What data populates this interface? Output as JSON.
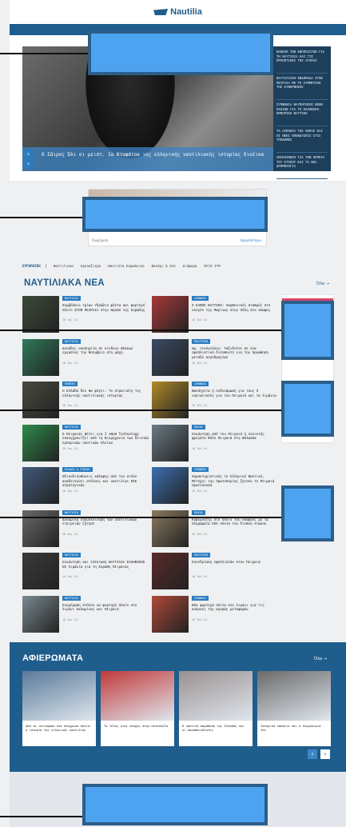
{
  "header": {
    "logo_text": "Nautilia"
  },
  "hero": {
    "caption": "Ο Σάιρος Ώλι οι μειστ. Ια Νταφάτοα ιης ελληνικής ναυτιλιακής ιστορίας διοέικα",
    "nav_prev": "‹",
    "nav_next": "›",
    "side_items": [
      "ΕΚΘΕΣΗ ΤΩΝ ΕΦΟΠΛΙΣΤΩΝ ΓΙΑ ΤΗ ΝΑΥΤΙΛΙΑ ΚΑΙ ΤΙΣ ΠΡΟΟΠΤΙΚΕΣ ΤΗΣ ΑΓΟΡΑΣ",
      "ΝΑΥΤΙΛΙΑΚΗ ΕΒΔΟΜΑΔΑ ΣΤΟΝ ΠΕΙΡΑΙΑ ΜΕ ΤΗ ΣΥΜΜΕΤΟΧΗ ΤΗΣ ΚΥΒΕΡΝΗΣΗΣ",
      "ΣΥΜΦΩΝΙΑ ΝΑΥΠΗΓΗΣΗΣ ΝΕΩΝ ΠΛΟΙΩΝ ΓΙΑ ΤΟ ΕΛΛΗΝΙΚΟ ΕΜΠΟΡΙΚΟ ΝΑΥΤΙΚΟ",
      "ΤΑ ΛΙΜΑΝΙΑ ΤΗΣ ΧΩΡΑΣ ΚΑΙ ΟΙ ΝΕΕΣ ΕΠΕΝΔΥΣΕΙΣ ΣΤΙΣ ΥΠΟΔΟΜΕΣ",
      "ΑΝΑΚΟΙΝΩΣΗ ΓΙΑ ΤΗΝ ΠΟΡΕΙΑ ΤΟΥ ΣΤΟΛΟΥ ΚΑΙ ΤΑ ΝΕΑ ΔΡΟΜΟΛΟΓΙΑ"
    ]
  },
  "ad": {
    "foot_left": "διαφήμιση",
    "foot_right": "περισσότερα ›"
  },
  "tabs": [
    "ΕΥΡΩΠΑΙΚΗ",
    "Ναυτιλιακα",
    "Κρουαζιέρα",
    "Ναυτιλία Ευρωπαικη",
    "Φανάρι & ΕΛΛ",
    "Διάφορα",
    "Μετά ΙΤΜ"
  ],
  "news": {
    "title": "ΝΑΥΤΙΛΙΑΚΑ ΝΕΑ",
    "all_link": "Όλα →",
    "items": [
      {
        "badge": "ΝΑΥΤΙΛΙΑ",
        "text": "Συμβόλαιο τρίων Υδρόβιο φλέτα και φορτηγό πλοίο ΣΤΟΝ ΠΕΙΡΑΙΑ στην Νησσό της Ευρώπης",
        "date": "18 Ιαν 24",
        "color": "#3c4a38"
      },
      {
        "badge": "ΛΙΜΑΝΙΑ",
        "text": "Ο ΚΑΒΟΣ ΝΑΥΤΙΚΟ: παρθενικός σταθμός στο νεογέο της Μαρίνας στην πόλη στο σκαφος",
        "date": "18 Ιαν 24",
        "color": "#a83a3a"
      },
      {
        "badge": "ΝΑΥΤΙΛΙΑ",
        "text": "Δεκάδες ναυπηγεία σε κίνδυνο θέσεων εργασίας την Νοεμβριο στη μάχη",
        "date": "18 Ιαν 24",
        "color": "#2f7a5a"
      },
      {
        "badge": "ΠΟΛΙΤΙΚΗ",
        "text": "Ημ. Ξενόγελλος: Ταξιδεύτε σε ένα εφοπλιστικό διευθυντή για την προώθηση μεταξύ αεροδρομίων",
        "date": "18 Ιαν 24",
        "color": "#3a4a64"
      },
      {
        "badge": "ΕΚΘΕΣΗ",
        "text": "Η Ελλάδα δεν θα φύγει: Το στρατιώτη της ελληνικής ναυτιλιακής ιστορίας",
        "date": "18 Ιαν 24",
        "color": "#4a4a40"
      },
      {
        "badge": "ΛΙΜΑΝΙΑ",
        "text": "Ναυπηγεία ή ενδυνάμωση για τους 4 νησιωτικούς για τον Πειραιά και τα λιμάνια",
        "date": "18 Ιαν 24",
        "color": "#b08a2a"
      },
      {
        "badge": "ΝΑΥΤΙΛΙΑ",
        "text": "Ο Πειραιάς θέτει για 2 ΑΝΑΝ Technology εκσυγχρονίζει από τη Βιομηχανία των δεικτών εμπορικών ναυτικών πλοίων",
        "date": "18 Ιαν 24",
        "color": "#2d8a4a"
      },
      {
        "badge": "ΠΛΟΙΑ",
        "text": "Συνάντηση από τον Πειραιά ή Ανοικτής φρεγάτα Βόλο Πειραιά στη θάλασσα",
        "date": "18 Ιαν 24",
        "color": "#6a7a84"
      },
      {
        "badge": "ΚΛΑΔΟΣ & ΣΤΟΛΟΣ",
        "text": "Οδικοδιευθύνεις κάλυψης από τον στόλο αναδεικνύει στόλους και ναυτιλίας ΕΕΕ στρατηγικών",
        "date": "18 Ιαν 24",
        "color": "#405a7a"
      },
      {
        "badge": "ΛΙΜΑΝΙΑ",
        "text": "Χαρακτηριστικός το Ελληνικό Ναυτικό, Μέτοχοι της πρωτοπορίας ζητούν το Πειραιά πρωτεύουσα",
        "date": "18 Ιαν 24",
        "color": "#3b6fb0"
      },
      {
        "badge": "ΝΑΥΤΙΛΙΑ",
        "text": "Δυναμική επανεκκίνηση των ναυτιλιακών εταιρειών ζήτησε",
        "date": "18 Ιαν 24",
        "color": "#6a6a6a"
      },
      {
        "badge": "ΠΛΟΙΑ",
        "text": "Κυβερνήτης στο πλοίο του σκάφους με τα πληρώματα ΕΕΕ πλοία του διεθνή Χιώνου",
        "date": "18 Ιαν 24",
        "color": "#8a7a60"
      },
      {
        "badge": "ΝΑΥΤΙΛΙΑ",
        "text": "Συνάντηση και επέκταση ΝΑΥΤΙΛΙΑ ΕΛΛΗΝΙΚΗΣ ΕΕ Λιμάνια για τη Ευρώπη Πειραιάς",
        "date": "18 Ιαν 24",
        "color": "#3a3a3a"
      },
      {
        "badge": "ΠΟΛΙΤΙΚΗ",
        "text": "Συνεδρίαση εφοπλιστών στον Πειραιά",
        "date": "18 Ιαν 24",
        "color": "#5a2a2a"
      },
      {
        "badge": "ΝΑΥΤΙΛΙΑ",
        "text": "Ενημέρωση στόλου να φορτηγό πλοίο στο λιμάνι Σαλαμίνας και Πειραιά",
        "date": "18 Ιαν 24",
        "color": "#7a8a90"
      },
      {
        "badge": "ΛΙΜΑΝΙΑ",
        "text": "Νέα φορτηγά πλοία στο λιμάνι για τις ανάγκες της αγοράς μεταφορών",
        "date": "18 Ιαν 24",
        "color": "#b04a3a"
      }
    ]
  },
  "afieromata": {
    "title": "ΑΦΙΕΡΩΜΑΤΑ",
    "all_link": "Όλα →",
    "cards": [
      {
        "text": "Από τα ιστιοφόρα στα σύγχρονα πλοία: η ιστορία της ελληνικής ναυτιλίας",
        "color": "#5a7a9a"
      },
      {
        "text": "Το τέλος μιας εποχής στην ακτοπλοΐα",
        "color": "#c03a3a"
      },
      {
        "text": "Η ναυτική παράδοση της Ελλάδας και οι προσωπικότητες",
        "color": "#9a9090"
      },
      {
        "text": "Ιστορικό ναυάγιο και η κληρονομιά του",
        "color": "#6a6a6a"
      }
    ],
    "nav_prev": "‹",
    "nav_next": "›"
  }
}
